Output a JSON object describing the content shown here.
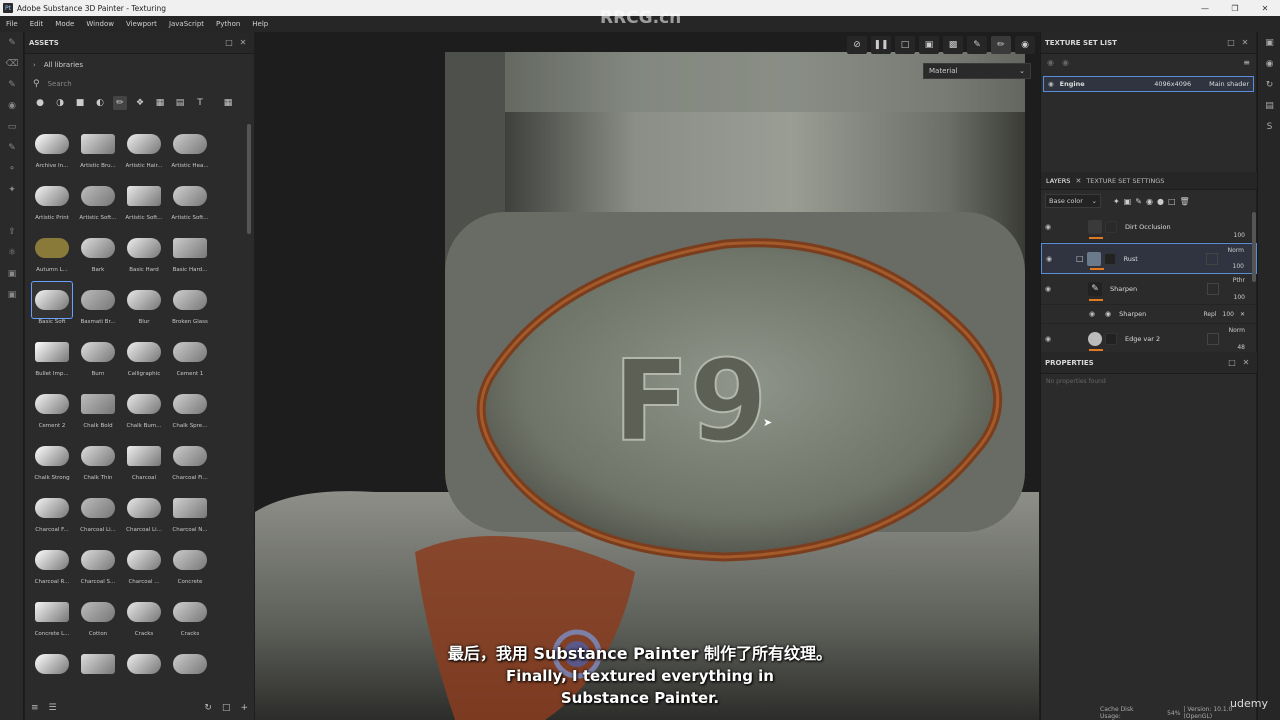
{
  "window": {
    "title": "Adobe Substance 3D Painter - Texturing",
    "app_icon": "Pt"
  },
  "menu": [
    "File",
    "Edit",
    "Mode",
    "Window",
    "Viewport",
    "JavaScript",
    "Python",
    "Help"
  ],
  "assets": {
    "title": "ASSETS",
    "library": "All libraries",
    "search_placeholder": "Search",
    "items": [
      "Archive In...",
      "Artistic Bru...",
      "Artistic Hair...",
      "Artistic Hea...",
      "Artistic Print",
      "Artistic Soft...",
      "Artistic Soft...",
      "Artistic Soft...",
      "Autumn L...",
      "Bark",
      "Basic Hard",
      "Basic Hard...",
      "Basic Soft",
      "Basmati Br...",
      "Blur",
      "Broken Glass",
      "Bullet Imp...",
      "Burn",
      "Calligraphic",
      "Cement 1",
      "Cement 2",
      "Chalk Bold",
      "Chalk Bum...",
      "Chalk Spre...",
      "Chalk Strong",
      "Chalk Thin",
      "Charcoal",
      "Charcoal Fi...",
      "Charcoal F...",
      "Charcoal Li...",
      "Charcoal Li...",
      "Charcoal N...",
      "Charcoal R...",
      "Charcoal S...",
      "Charcoal ...",
      "Concrete",
      "Concrete L...",
      "Cotton",
      "Cracks",
      "Cracks",
      "",
      "",
      "",
      ""
    ],
    "selected_item": "Basic Soft"
  },
  "viewport": {
    "channel_dropdown": "Material",
    "embossed_text": "F9"
  },
  "texture_set_list": {
    "title": "TEXTURE SET LIST",
    "row": {
      "name": "Engine",
      "resolution": "4096x4096",
      "shader": "Main shader"
    }
  },
  "layers": {
    "tab_layers": "LAYERS",
    "tab_settings": "TEXTURE SET SETTINGS",
    "channel": "Base color",
    "items": [
      {
        "name": "Dirt Occlusion",
        "blend": "",
        "opacity": "100"
      },
      {
        "name": "Rust",
        "blend": "Norm",
        "opacity": "100"
      },
      {
        "name": "Sharpen",
        "blend": "Pthr",
        "opacity": "100"
      },
      {
        "name": "Sharpen",
        "blend": "Repl",
        "opacity": "100"
      },
      {
        "name": "Edge var 2",
        "blend": "Norm",
        "opacity": "48"
      }
    ]
  },
  "properties": {
    "title": "PROPERTIES",
    "empty_text": "No properties found"
  },
  "status": {
    "cache_label": "Cache Disk Usage:",
    "cache_value": "54%",
    "version": "| Version: 10.1.0 (OpenGL)"
  },
  "overlay": {
    "watermark": "RRCG.cn",
    "subtitle_zh": "最后，我用 Substance Painter 制作了所有纹理。",
    "subtitle_en_1": "Finally, I textured everything in",
    "subtitle_en_2": "Substance Painter.",
    "brand": "udemy"
  },
  "colors": {
    "accent": "#5a8fd8",
    "rust": "#e07a20"
  }
}
